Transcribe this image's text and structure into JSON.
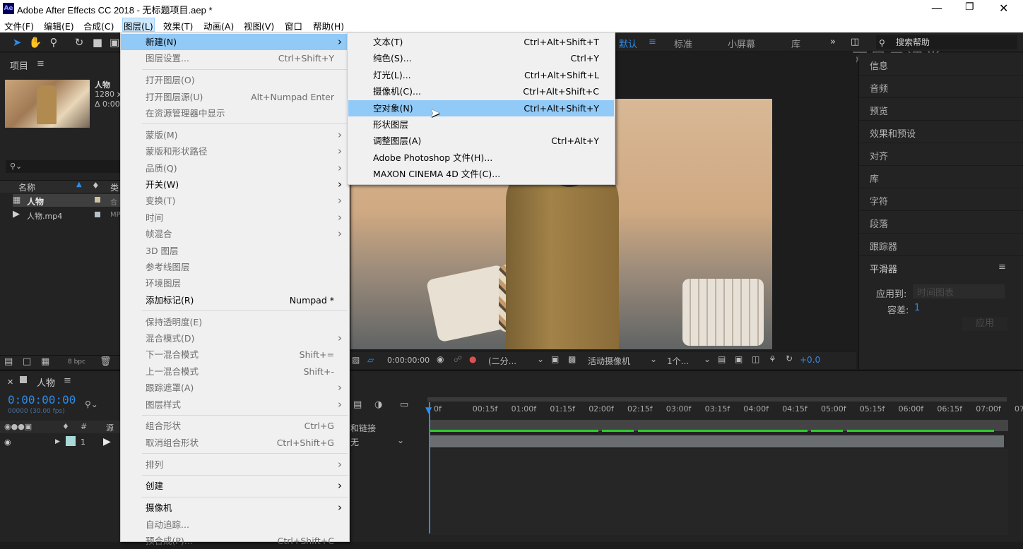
{
  "window": {
    "title": "Adobe After Effects CC 2018 - 无标题项目.aep *",
    "logo": "Ae",
    "controls": [
      "minimize-icon",
      "maximize-icon",
      "close-icon"
    ]
  },
  "menubar": [
    "文件(F)",
    "编辑(E)",
    "合成(C)",
    "图层(L)",
    "效果(T)",
    "动画(A)",
    "视图(V)",
    "窗口",
    "帮助(H)"
  ],
  "workspaces": [
    "默认",
    "标准",
    "小屏幕",
    "库"
  ],
  "search_placeholder": "搜索帮助",
  "watermark": "网易云课堂",
  "project": {
    "header": "项目",
    "selected_name": "人物",
    "selected_info1": "1280 x",
    "selected_info2": "Δ 0:00",
    "col_name": "名称",
    "col_type": "类",
    "items": [
      {
        "name": "人物",
        "type": "合"
      },
      {
        "name": "人物.mp4",
        "type": "MP"
      }
    ],
    "bpc": "8 bpc"
  },
  "layer_menu": [
    {
      "label": "新建(N)",
      "shortcut": "",
      "arrow": true,
      "disabled": false,
      "highlight": true
    },
    {
      "label": "图层设置...",
      "shortcut": "Ctrl+Shift+Y",
      "arrow": false,
      "disabled": true
    },
    {
      "sep": true
    },
    {
      "label": "打开图层(O)",
      "shortcut": "",
      "arrow": false,
      "disabled": true
    },
    {
      "label": "打开图层源(U)",
      "shortcut": "Alt+Numpad Enter",
      "arrow": false,
      "disabled": true
    },
    {
      "label": "在资源管理器中显示",
      "shortcut": "",
      "arrow": false,
      "disabled": true
    },
    {
      "sep": true
    },
    {
      "label": "蒙版(M)",
      "shortcut": "",
      "arrow": true,
      "disabled": true
    },
    {
      "label": "蒙版和形状路径",
      "shortcut": "",
      "arrow": true,
      "disabled": true
    },
    {
      "label": "品质(Q)",
      "shortcut": "",
      "arrow": true,
      "disabled": true
    },
    {
      "label": "开关(W)",
      "shortcut": "",
      "arrow": true,
      "disabled": false
    },
    {
      "label": "变换(T)",
      "shortcut": "",
      "arrow": true,
      "disabled": true
    },
    {
      "label": "时间",
      "shortcut": "",
      "arrow": true,
      "disabled": true
    },
    {
      "label": "帧混合",
      "shortcut": "",
      "arrow": true,
      "disabled": true
    },
    {
      "label": "3D 图层",
      "shortcut": "",
      "arrow": false,
      "disabled": true
    },
    {
      "label": "参考线图层",
      "shortcut": "",
      "arrow": false,
      "disabled": true
    },
    {
      "label": "环境图层",
      "shortcut": "",
      "arrow": false,
      "disabled": true
    },
    {
      "label": "添加标记(R)",
      "shortcut": "Numpad *",
      "arrow": false,
      "disabled": false
    },
    {
      "sep": true
    },
    {
      "label": "保持透明度(E)",
      "shortcut": "",
      "arrow": false,
      "disabled": true
    },
    {
      "label": "混合模式(D)",
      "shortcut": "",
      "arrow": true,
      "disabled": true
    },
    {
      "label": "下一混合模式",
      "shortcut": "Shift+=",
      "arrow": false,
      "disabled": true
    },
    {
      "label": "上一混合模式",
      "shortcut": "Shift+-",
      "arrow": false,
      "disabled": true
    },
    {
      "label": "跟踪遮罩(A)",
      "shortcut": "",
      "arrow": true,
      "disabled": true
    },
    {
      "label": "图层样式",
      "shortcut": "",
      "arrow": true,
      "disabled": true
    },
    {
      "sep": true
    },
    {
      "label": "组合形状",
      "shortcut": "Ctrl+G",
      "arrow": false,
      "disabled": true
    },
    {
      "label": "取消组合形状",
      "shortcut": "Ctrl+Shift+G",
      "arrow": false,
      "disabled": true
    },
    {
      "sep": true
    },
    {
      "label": "排列",
      "shortcut": "",
      "arrow": true,
      "disabled": true
    },
    {
      "sep": true
    },
    {
      "label": "创建",
      "shortcut": "",
      "arrow": true,
      "disabled": false
    },
    {
      "sep": true
    },
    {
      "label": "摄像机",
      "shortcut": "",
      "arrow": true,
      "disabled": false
    },
    {
      "label": "自动追踪...",
      "shortcut": "",
      "arrow": false,
      "disabled": true
    },
    {
      "label": "预合成(P)...",
      "shortcut": "Ctrl+Shift+C",
      "arrow": false,
      "disabled": true
    }
  ],
  "new_submenu": [
    {
      "label": "文本(T)",
      "shortcut": "Ctrl+Alt+Shift+T"
    },
    {
      "label": "纯色(S)...",
      "shortcut": "Ctrl+Y"
    },
    {
      "label": "灯光(L)...",
      "shortcut": "Ctrl+Alt+Shift+L"
    },
    {
      "label": "摄像机(C)...",
      "shortcut": "Ctrl+Alt+Shift+C"
    },
    {
      "label": "空对象(N)",
      "shortcut": "Ctrl+Alt+Shift+Y",
      "highlight": true
    },
    {
      "label": "形状图层",
      "shortcut": ""
    },
    {
      "label": "调整图层(A)",
      "shortcut": "Ctrl+Alt+Y"
    },
    {
      "label": "Adobe Photoshop 文件(H)...",
      "shortcut": ""
    },
    {
      "label": "MAXON CINEMA 4D 文件(C)...",
      "shortcut": ""
    }
  ],
  "viewer": {
    "timecode": "0:00:00:00",
    "resolution": "(二分...",
    "camera": "活动摄像机",
    "views": "1个...",
    "exposure": "+0.0"
  },
  "right_panel": [
    "信息",
    "音频",
    "预览",
    "效果和预设",
    "对齐",
    "库",
    "字符",
    "段落",
    "跟踪器"
  ],
  "smoother": {
    "title": "平滑器",
    "apply_to_label": "应用到:",
    "apply_to_value": "时间图表",
    "tolerance_label": "容差:",
    "tolerance_value": "1",
    "apply_button": "应用"
  },
  "timeline": {
    "comp_name": "人物",
    "timecode": "0:00:00:00",
    "timecode_sub": "00000 (30.00 fps)",
    "col_source": "源",
    "col_parent": "和链接",
    "layer_index": "1",
    "parent_value": "无",
    "ticks": [
      "0f",
      "00:15f",
      "01:00f",
      "01:15f",
      "02:00f",
      "02:15f",
      "03:00f",
      "03:15f",
      "04:00f",
      "04:15f",
      "05:00f",
      "05:15f",
      "06:00f",
      "06:15f",
      "07:00f",
      "07:"
    ]
  },
  "colors": {
    "accent_blue": "#2d8ceb",
    "menu_highlight": "#91c9f7",
    "menu_bg": "#f0f0f0"
  }
}
